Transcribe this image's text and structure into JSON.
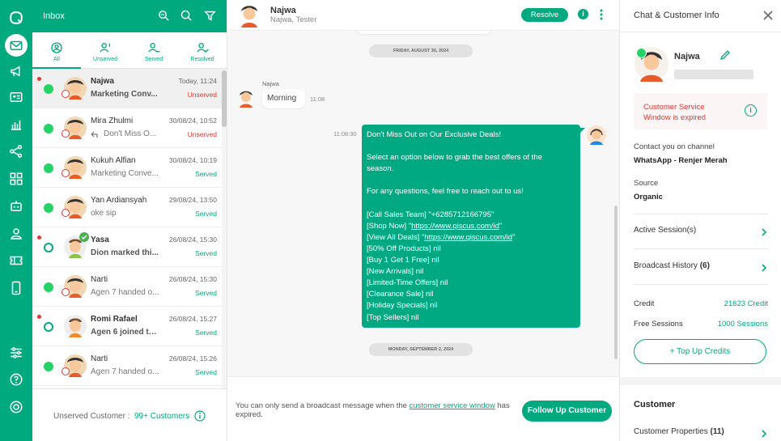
{
  "colors": {
    "primary": "#01AA7E",
    "unserved": "#e53935",
    "bubble_out": "#01A982"
  },
  "rail": {
    "icons": [
      "app-logo",
      "inbox-icon",
      "megaphone-icon",
      "contact-card-icon",
      "chart-icon",
      "flow-icon",
      "apps-icon",
      "robot-icon",
      "agent-icon",
      "ticket-icon",
      "mobile-icon",
      "settings-sliders-icon",
      "help-icon",
      "power-icon"
    ]
  },
  "inbox": {
    "title": "Inbox",
    "tabs": [
      {
        "label": "All",
        "icon": "user-circle-icon"
      },
      {
        "label": "Unserved",
        "icon": "user-alert-icon"
      },
      {
        "label": "Served",
        "icon": "user-minus-icon"
      },
      {
        "label": "Resolved",
        "icon": "user-check-icon"
      }
    ],
    "rows": [
      {
        "name": "Najwa",
        "time": "Today, 11:24",
        "msg": "Marketing Conv...",
        "status": "Unserved"
      },
      {
        "name": "Mira Zhulmi",
        "time": "30/08/24, 10:52",
        "msg": "Don't Miss O...",
        "status": "Unserved"
      },
      {
        "name": "Kukuh Alfian",
        "time": "30/08/24, 10:19",
        "msg": "Marketing Conve...",
        "status": "Served"
      },
      {
        "name": "Yan Ardiansyah",
        "time": "29/08/24, 13:50",
        "msg": "oke sip",
        "status": "Served"
      },
      {
        "name": "Yasa",
        "time": "26/08/24, 15:30",
        "msg": "Dion marked thi...",
        "status": "Served"
      },
      {
        "name": "Narti",
        "time": "26/08/24, 15:30",
        "msg": "Agen 7 handed o...",
        "status": "Served"
      },
      {
        "name": "Romi Rafael",
        "time": "26/08/24, 15:27",
        "msg": "Agen 6 joined th...",
        "status": "Served"
      },
      {
        "name": "Narti",
        "time": "26/08/24, 15:26",
        "msg": "Agen 7 handed o...",
        "status": "Served"
      }
    ],
    "footer": {
      "label": "Unserved Customer :",
      "value": "99+ Customers"
    }
  },
  "chat": {
    "name": "Najwa",
    "subtitle": "Najwa, Tester",
    "resolve": "Resolve",
    "date1": "FRIDAY, AUGUST 30, 2024",
    "date2": "MONDAY, SEPTEMBER 2, 2024",
    "in_sender": "Najwa",
    "in_text": "Morning",
    "in_time": "11:08",
    "out_time": "11:08:30",
    "out_lines": [
      "Don't Miss Out on Our Exclusive Deals!",
      "",
      "Select an option below to grab the best offers of the",
      "season.",
      "",
      "For any questions, feel free to reach out to us!",
      "",
      "[Call Sales Team] \"+6285712166795\"",
      "[Shop Now] \"https://www.qiscus.com/id\"",
      "[View All Deals] \"https://www.qiscus.com/id\"",
      "[50% Off Products] nil",
      "[Buy 1 Get 1 Free] nil",
      "[New Arrivals] nil",
      "[Limited-Time Offers] nil",
      "[Clearance Sale] nil",
      "[Holiday Specials] nil",
      "[Top Sellers] nil"
    ],
    "footer_text_a": "You can only send a broadcast message when the ",
    "footer_link": "customer service window",
    "footer_text_b": " has expired.",
    "follow_up": "Follow Up Customer"
  },
  "info": {
    "title": "Chat & Customer Info",
    "name": "Najwa",
    "alert": "Customer Service Window is expired",
    "channel_label": "Contact you on channel",
    "channel_value": "WhatsApp - Renjer Merah",
    "source_label": "Source",
    "source_value": "Organic",
    "active_sessions": "Active Session(s)",
    "broadcast_history": "Broadcast History",
    "broadcast_count": "(6)",
    "credit_label": "Credit",
    "credit_value": "21623 Credit",
    "free_label": "Free Sessions",
    "free_value": "1000 Sessions",
    "top_up": "+ Top Up Credits",
    "customer_heading": "Customer",
    "customer_properties": "Customer Properties",
    "customer_properties_count": "(11)"
  }
}
